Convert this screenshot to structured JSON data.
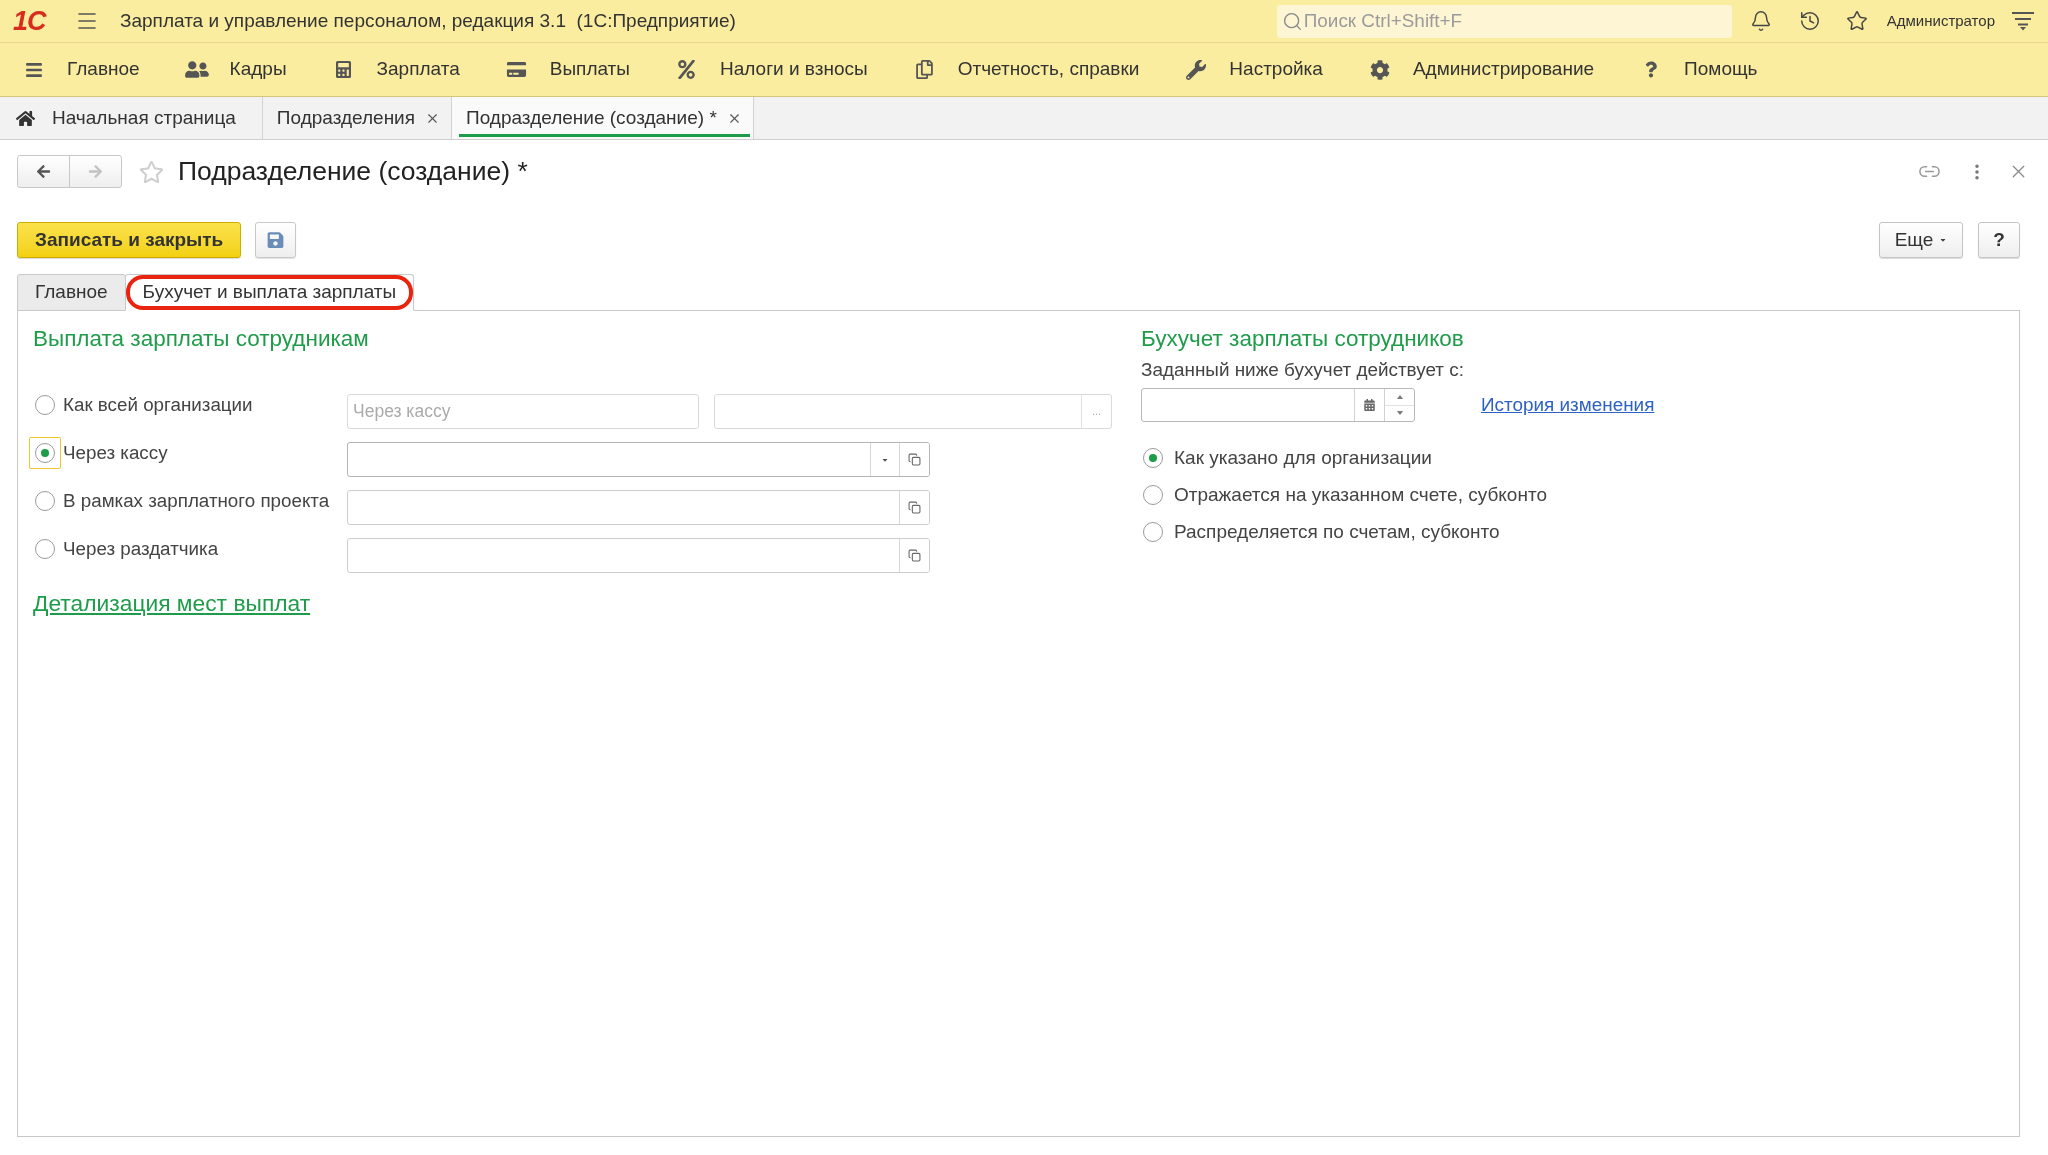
{
  "header": {
    "logo": "1С",
    "title": "Зарплата и управление персоналом, редакция 3.1  (1С:Предприятие)",
    "search": {
      "placeholder": "Поиск Ctrl+Shift+F"
    },
    "user": "Администратор"
  },
  "main_menu": [
    {
      "label": "Главное"
    },
    {
      "label": "Кадры"
    },
    {
      "label": "Зарплата"
    },
    {
      "label": "Выплаты"
    },
    {
      "label": "Налоги и взносы"
    },
    {
      "label": "Отчетность, справки"
    },
    {
      "label": "Настройка"
    },
    {
      "label": "Администрирование"
    },
    {
      "label": "Помощь"
    }
  ],
  "open_tabs": [
    {
      "label": "Начальная страница",
      "kind": "home",
      "selected": false
    },
    {
      "label": "Подразделения",
      "kind": "form",
      "selected": false
    },
    {
      "label": "Подразделение (создание) *",
      "kind": "form",
      "selected": true
    }
  ],
  "form": {
    "navigation": [
      {
        "kind": "back",
        "disabled": false
      },
      {
        "kind": "forward",
        "disabled": true
      }
    ],
    "favorite": false,
    "title": "Подразделение (создание) *",
    "buttons": {
      "save_and_close": "Записать и закрыть",
      "more": "Еще",
      "help": "?"
    },
    "tabs": [
      {
        "label": "Главное",
        "selected": false,
        "highlighted": false
      },
      {
        "label": "Бухучет и выплата зарплаты",
        "selected": true,
        "highlighted": true
      }
    ],
    "payment": {
      "heading": "Выплата зарплаты сотрудникам",
      "options": [
        {
          "label": "Как всей организации",
          "selected": false,
          "focused": false,
          "kind": "inherited",
          "value": "Через кассу",
          "choose_button": "..."
        },
        {
          "label": "Через кассу",
          "selected": true,
          "focused": true,
          "kind": "dropdown"
        },
        {
          "label": "В рамках зарплатного проекта",
          "selected": false,
          "focused": false,
          "kind": "open"
        },
        {
          "label": "Через раздатчика",
          "selected": false,
          "focused": false,
          "kind": "open"
        }
      ],
      "details_link": "Детализация мест выплат"
    },
    "accounting": {
      "heading": "Бухучет зарплаты сотрудников",
      "date_label": "Заданный ниже бухучет действует с:",
      "history_link": "История изменения",
      "options": [
        {
          "label": "Как указано для организации",
          "selected": true
        },
        {
          "label": "Отражается на указанном счете, субконто",
          "selected": false
        },
        {
          "label": "Распределяется по счетам, субконто",
          "selected": false
        }
      ]
    }
  }
}
